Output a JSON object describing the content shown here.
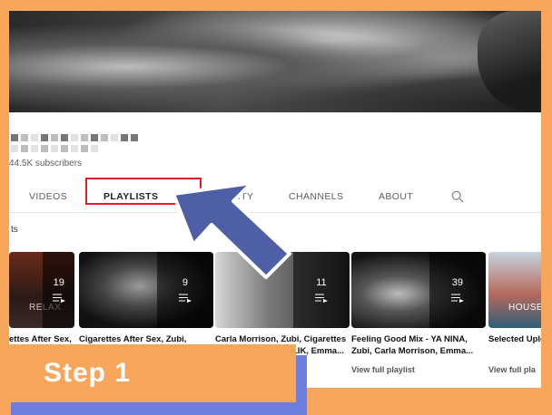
{
  "channel": {
    "subscribers": "44.5K subscribers"
  },
  "tabs": [
    {
      "label": "VIDEOS"
    },
    {
      "label": "PLAYLISTS"
    },
    {
      "label": "COMMUNITY"
    },
    {
      "label": "CHANNELS"
    },
    {
      "label": "ABOUT"
    }
  ],
  "section": {
    "label": "ts"
  },
  "playlists": [
    {
      "count": "19",
      "title": "ettes After Sex,",
      "thumb_text": "RELAX"
    },
    {
      "count": "9",
      "title": "Cigarettes After Sex, Zubi,",
      "thumb_text": ""
    },
    {
      "count": "11",
      "title": "Carla Morrison, Zubi, Cigarettes",
      "title2": "LIK, Emma...",
      "thumb_text": ""
    },
    {
      "count": "39",
      "title": "Feeling Good Mix - YA NINA,",
      "title2": "Zubi, Carla Morrison, Emma...",
      "thumb_text": "",
      "link": "View full playlist"
    },
    {
      "count": "",
      "title": "Selected Uplo",
      "thumb_text": "HOUSE",
      "link": "View full pla"
    }
  ],
  "overlay_step": {
    "label": "Step 1"
  },
  "icons": {
    "search": "search-icon",
    "playlist": "playlist-icon",
    "arrow": "pointer-arrow-icon"
  },
  "colors": {
    "background": "#f7a65b",
    "highlight": "#e02020",
    "arrow": "#4e5fa8",
    "step_shadow": "#6b7ee0"
  }
}
